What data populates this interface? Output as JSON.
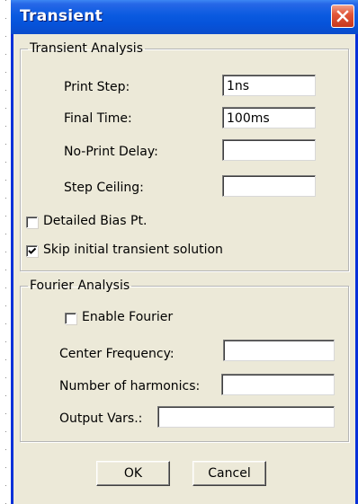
{
  "window": {
    "title": "Transient"
  },
  "transient_analysis": {
    "legend": "Transient Analysis",
    "print_step": {
      "label": "Print Step:",
      "value": "1ns"
    },
    "final_time": {
      "label": "Final Time:",
      "value": "100ms"
    },
    "no_print_delay": {
      "label": "No-Print Delay:",
      "value": ""
    },
    "step_ceiling": {
      "label": "Step Ceiling:",
      "value": ""
    },
    "detailed_bias": {
      "label": "Detailed Bias Pt.",
      "checked": false
    },
    "skip_initial": {
      "label": "Skip initial transient solution",
      "checked": true
    }
  },
  "fourier_analysis": {
    "legend": "Fourier Analysis",
    "enable_fourier": {
      "label": "Enable Fourier",
      "checked": false
    },
    "center_frequency": {
      "label": "Center Frequency:",
      "value": ""
    },
    "num_harmonics": {
      "label": "Number of harmonics:",
      "value": ""
    },
    "output_vars": {
      "label": "Output Vars.:",
      "value": ""
    }
  },
  "buttons": {
    "ok": "OK",
    "cancel": "Cancel"
  },
  "colors": {
    "title_bar": "#0a5ae0",
    "close_button": "#e2573a",
    "dialog_face": "#ece9d8"
  },
  "icons": {
    "close": "close-icon",
    "check": "checkmark-icon"
  }
}
